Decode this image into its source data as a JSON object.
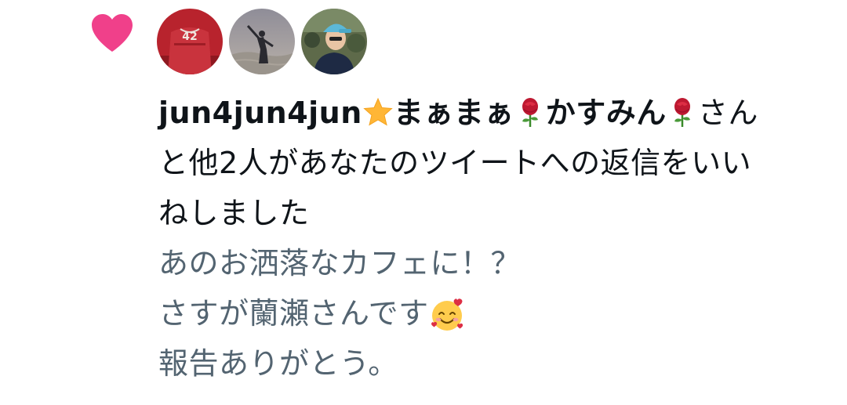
{
  "notification": {
    "type_icon": "heart-icon",
    "accent_color": "#f91880",
    "avatars": [
      {
        "name": "avatar-red-jersey"
      },
      {
        "name": "avatar-silhouette"
      },
      {
        "name": "avatar-person-cap"
      }
    ],
    "users": [
      {
        "display_name": "jun4jun4jun",
        "emoji": "star-emoji"
      },
      {
        "display_name": "まぁまぁ",
        "emoji": "rose-emoji"
      },
      {
        "display_name": "かすみん",
        "emoji": "rose-emoji"
      }
    ],
    "summary_suffix_1": "さん",
    "summary_suffix_2": "と他2人があなたのツイートへの返信をいい",
    "summary_suffix_3": "ねしました",
    "jersey_number": "42"
  },
  "tweet": {
    "lines": [
      "あのお洒落なカフェに！？",
      "さすが蘭瀬さんです",
      "報告ありがとう。"
    ],
    "inline_emoji": "smiling-face-with-hearts-emoji"
  },
  "colors": {
    "primary_text": "#0f1419",
    "secondary_text": "#536471",
    "like_pink": "#f91880"
  }
}
